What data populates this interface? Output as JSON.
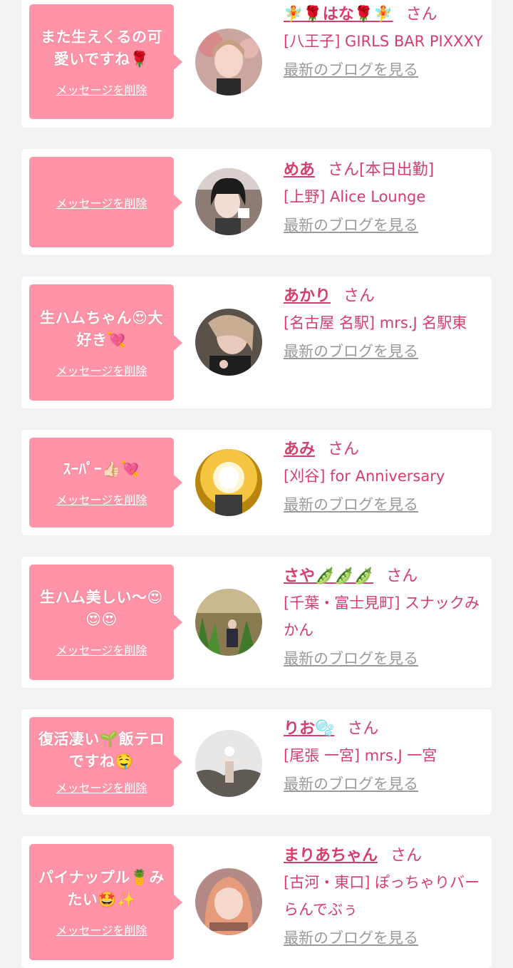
{
  "colors": {
    "accent": "#d63d6b",
    "bubble": "#ff94a8",
    "background": "#f2f2f2",
    "link_gray": "#9a9a9a"
  },
  "messages": [
    {
      "message": "また生えくるの可愛いですね🌹",
      "delete_label": "メッセージを削除",
      "name": "🧚🌹はな🌹🧚",
      "honorific": "さん",
      "shop": "[八王子] GIRLS BAR PIXXXY",
      "blog_label": "最新のブログを見る",
      "avatar_icon": "user-photo-icon"
    },
    {
      "message": "",
      "delete_label": "メッセージを削除",
      "name": "めあ",
      "honorific": "さん[本日出勤]",
      "shop": "[上野] Alice Lounge",
      "blog_label": "最新のブログを見る",
      "avatar_icon": "user-photo-icon"
    },
    {
      "message": "生ハムちゃん😍大好き💘",
      "delete_label": "メッセージを削除",
      "name": "あかり",
      "honorific": "さん",
      "shop": "[名古屋 名駅] mrs.J 名駅東",
      "blog_label": "最新のブログを見る",
      "avatar_icon": "user-photo-icon"
    },
    {
      "message": "ｽｰﾊﾟｰ👍🏻💘",
      "delete_label": "メッセージを削除",
      "name": "あみ",
      "honorific": "さん",
      "shop": "[刈谷] for Anniversary",
      "blog_label": "最新のブログを見る",
      "avatar_icon": "user-photo-icon"
    },
    {
      "message": "生ハム美しい〜😍😍😍",
      "delete_label": "メッセージを削除",
      "name": "さや🫛🫛🫛",
      "honorific": "さん",
      "shop": "[千葉・富士見町] スナックみかん",
      "blog_label": "最新のブログを見る",
      "avatar_icon": "user-photo-icon"
    },
    {
      "message": "復活凄い🌱飯テロですね🤤",
      "delete_label": "メッセージを削除",
      "name": "りお🫧",
      "honorific": "さん",
      "shop": "[尾張 一宮] mrs.J 一宮",
      "blog_label": "最新のブログを見る",
      "avatar_icon": "user-photo-icon"
    },
    {
      "message": "パイナップル🍍みたい🤩✨",
      "delete_label": "メッセージを削除",
      "name": "まりあちゃん",
      "honorific": "さん",
      "shop": "[古河・東口] ぽっちゃりバー らんでぶぅ",
      "blog_label": "最新のブログを見る",
      "avatar_icon": "user-photo-icon"
    }
  ]
}
